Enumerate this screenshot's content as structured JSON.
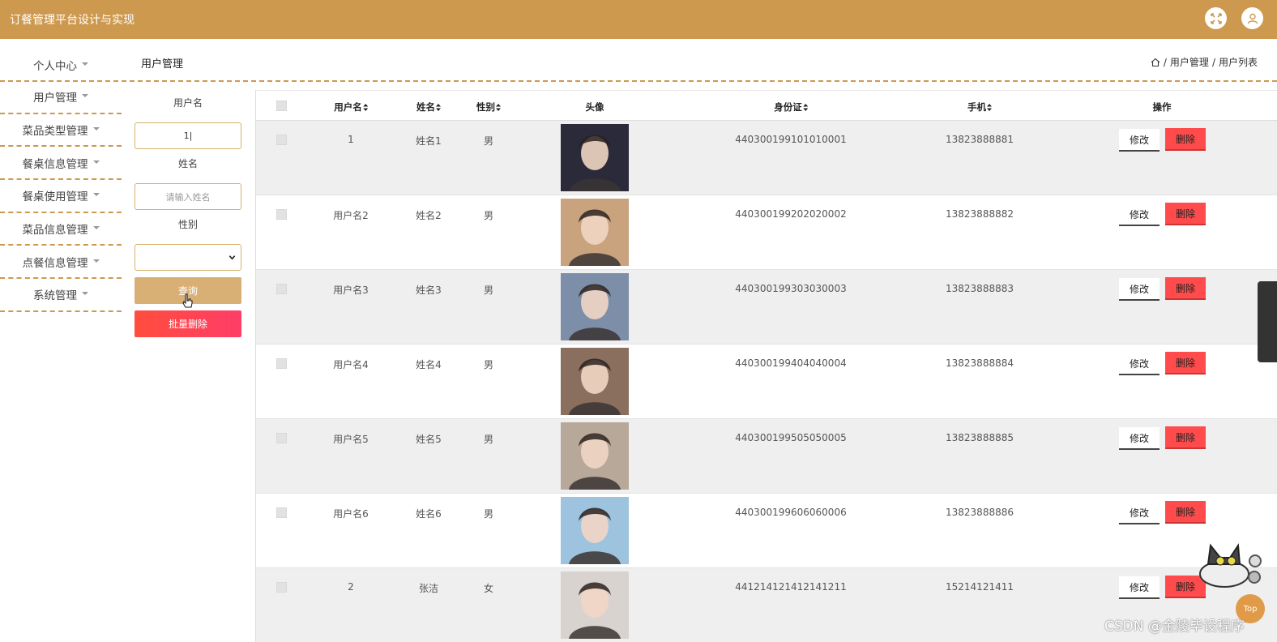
{
  "app": {
    "title": "订餐管理平台设计与实现"
  },
  "sidebar": {
    "items": [
      {
        "label": "个人中心"
      },
      {
        "label": "用户管理"
      },
      {
        "label": "菜品类型管理"
      },
      {
        "label": "餐桌信息管理"
      },
      {
        "label": "餐桌使用管理"
      },
      {
        "label": "菜品信息管理"
      },
      {
        "label": "点餐信息管理"
      },
      {
        "label": "系统管理"
      }
    ]
  },
  "page": {
    "title": "用户管理",
    "breadcrumb": [
      "用户管理",
      "用户列表"
    ],
    "breadcrumb_sep": "/"
  },
  "filter": {
    "username_label": "用户名",
    "username_value": "1|",
    "name_label": "姓名",
    "name_placeholder": "请输入姓名",
    "gender_label": "性别",
    "gender_value": "",
    "search_label": "查询",
    "batch_delete_label": "批量删除"
  },
  "table": {
    "headers": {
      "username": "用户名",
      "name": "姓名",
      "gender": "性别",
      "avatar": "头像",
      "id_card": "身份证",
      "phone": "手机",
      "actions": "操作"
    },
    "edit_label": "修改",
    "delete_label": "删除",
    "rows": [
      {
        "username": "1",
        "name": "姓名1",
        "gender": "男",
        "id_card": "440300199101010001",
        "phone": "13823888881",
        "avatar_color": "#2b2a3a"
      },
      {
        "username": "用户名2",
        "name": "姓名2",
        "gender": "男",
        "id_card": "440300199202020002",
        "phone": "13823888882",
        "avatar_color": "#c9a27e"
      },
      {
        "username": "用户名3",
        "name": "姓名3",
        "gender": "男",
        "id_card": "440300199303030003",
        "phone": "13823888883",
        "avatar_color": "#7d8fa8"
      },
      {
        "username": "用户名4",
        "name": "姓名4",
        "gender": "男",
        "id_card": "440300199404040004",
        "phone": "13823888884",
        "avatar_color": "#8a6f5e"
      },
      {
        "username": "用户名5",
        "name": "姓名5",
        "gender": "男",
        "id_card": "440300199505050005",
        "phone": "13823888885",
        "avatar_color": "#b7a899"
      },
      {
        "username": "用户名6",
        "name": "姓名6",
        "gender": "男",
        "id_card": "440300199606060006",
        "phone": "13823888886",
        "avatar_color": "#9ec3de"
      },
      {
        "username": "2",
        "name": "张洁",
        "gender": "女",
        "id_card": "441214121412141211",
        "phone": "15214121411",
        "avatar_color": "#d9d3cf"
      }
    ]
  },
  "widgets": {
    "top_button": "Top",
    "watermark": "CSDN @金陵毕设程序"
  },
  "colors": {
    "brand": "#cd994f",
    "danger": "#ff4b4b",
    "search_button": "#d8af74"
  }
}
